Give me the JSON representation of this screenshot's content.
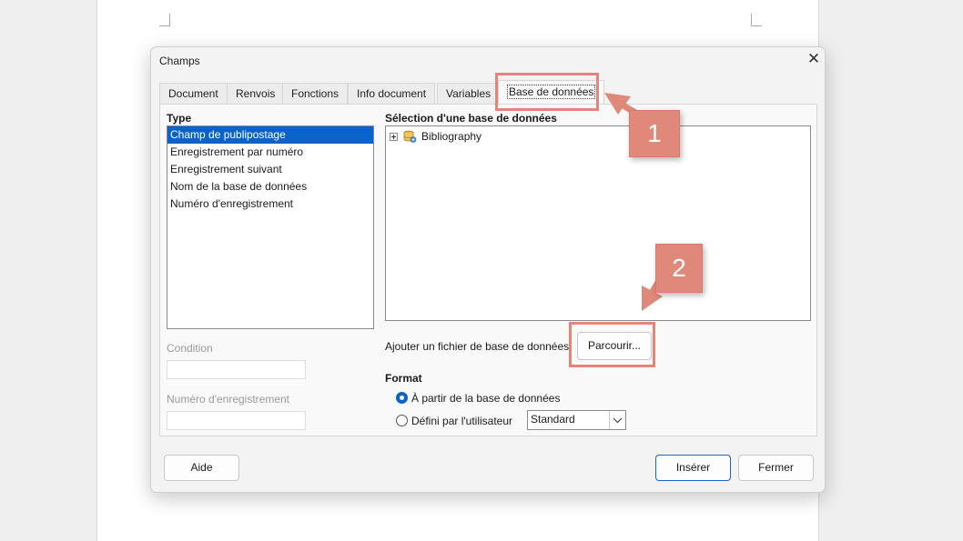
{
  "dialog": {
    "title": "Champs",
    "close_glyph": "✕"
  },
  "tabs": [
    {
      "label": "Document"
    },
    {
      "label": "Renvois"
    },
    {
      "label": "Fonctions"
    },
    {
      "label": "Info document"
    },
    {
      "label": "Variables"
    },
    {
      "label": "Base de données"
    }
  ],
  "type_section": {
    "label": "Type",
    "items": [
      {
        "label": "Champ de publipostage"
      },
      {
        "label": "Enregistrement par numéro"
      },
      {
        "label": "Enregistrement suivant"
      },
      {
        "label": "Nom de la base de données"
      },
      {
        "label": "Numéro d'enregistrement"
      }
    ]
  },
  "condition": {
    "label": "Condition",
    "value": ""
  },
  "record_number": {
    "label": "Numéro d'enregistrement",
    "value": ""
  },
  "database_section": {
    "label": "Sélection d'une base de données",
    "tree": [
      {
        "label": "Bibliography",
        "icon": "database-icon"
      }
    ]
  },
  "add_database": {
    "label": "Ajouter un fichier de base de données",
    "browse_label": "Parcourir..."
  },
  "format": {
    "label": "Format",
    "option_database": "À partir de la base de données",
    "option_user": "Défini par l'utilisateur",
    "user_format_value": "Standard"
  },
  "buttons": {
    "help": "Aide",
    "insert": "Insérer",
    "close": "Fermer"
  },
  "annotations": {
    "step1": "1",
    "step2": "2",
    "color": "#e0897b"
  }
}
